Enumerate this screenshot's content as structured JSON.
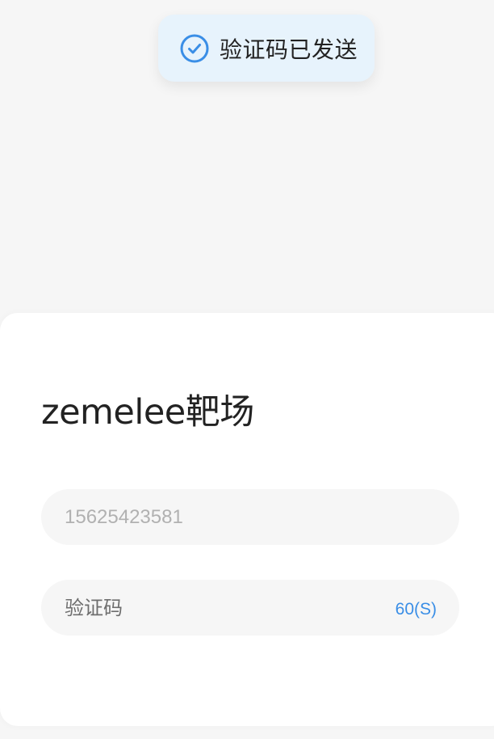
{
  "toast": {
    "icon": "check-circle-icon",
    "message": "验证码已发送",
    "accent_color": "#3a8ee6"
  },
  "login": {
    "title": "zemelee靶场",
    "phone_placeholder": "15625423581",
    "code_placeholder": "验证码",
    "countdown": "60(S)"
  }
}
